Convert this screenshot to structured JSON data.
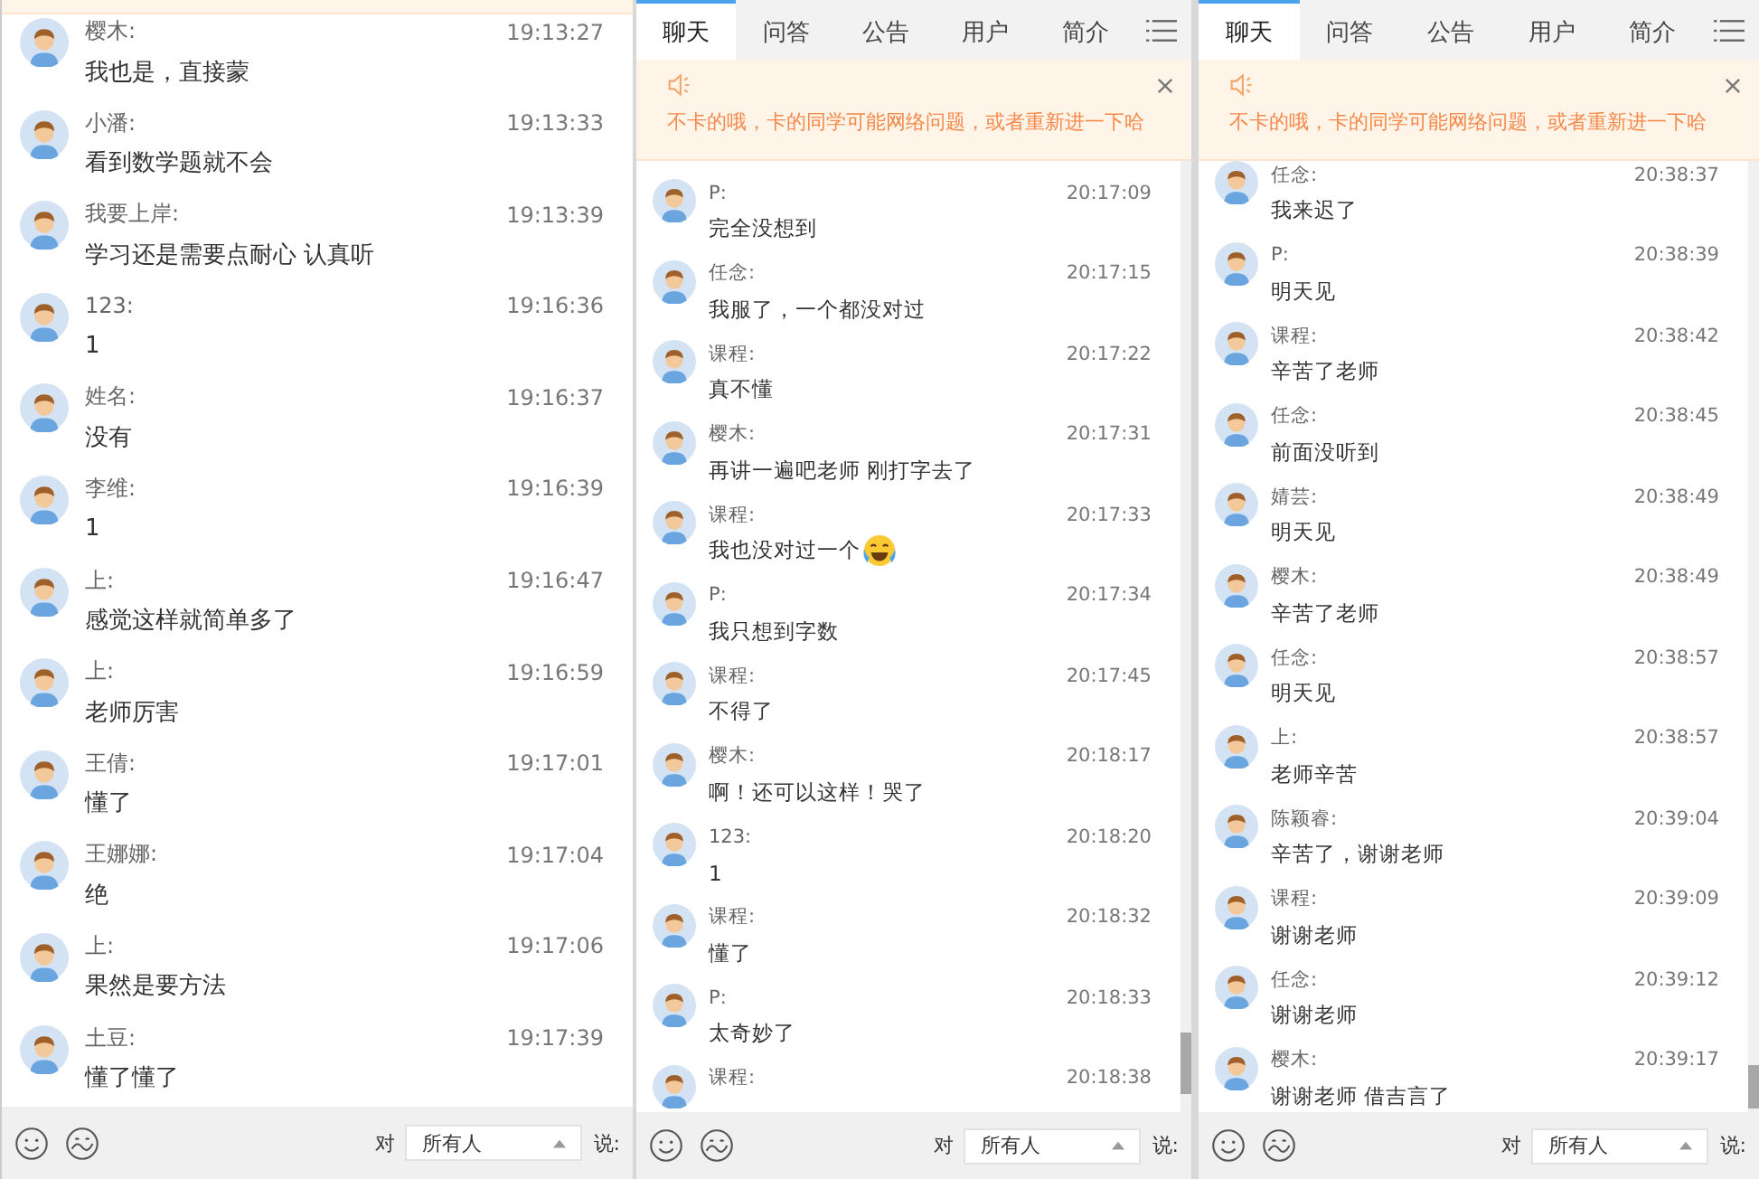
{
  "panels": [
    {
      "notice": {
        "collapsed": true
      },
      "messages": [
        {
          "name": "樱木:",
          "time": "19:13:27",
          "text": "我也是，直接蒙"
        },
        {
          "name": "小潘:",
          "time": "19:13:33",
          "text": "看到数学题就不会"
        },
        {
          "name": "我要上岸:",
          "time": "19:13:39",
          "text": "学习还是需要点耐心 认真听"
        },
        {
          "name": "123:",
          "time": "19:16:36",
          "text": "1"
        },
        {
          "name": "姓名:",
          "time": "19:16:37",
          "text": "没有"
        },
        {
          "name": "李维:",
          "time": "19:16:39",
          "text": "1"
        },
        {
          "name": "上:",
          "time": "19:16:47",
          "text": "感觉这样就简单多了"
        },
        {
          "name": "上:",
          "time": "19:16:59",
          "text": "老师厉害"
        },
        {
          "name": "王倩:",
          "time": "19:17:01",
          "text": "懂了"
        },
        {
          "name": "王娜娜:",
          "time": "19:17:04",
          "text": "绝"
        },
        {
          "name": "上:",
          "time": "19:17:06",
          "text": "果然是要方法"
        },
        {
          "name": "土豆:",
          "time": "19:17:39",
          "text": "懂了懂了"
        }
      ],
      "footer": {
        "to_label": "对",
        "recipient": "所有人",
        "say_label": "说:"
      }
    },
    {
      "tabs": [
        {
          "label": "聊天",
          "selected": true
        },
        {
          "label": "问答",
          "selected": false
        },
        {
          "label": "公告",
          "selected": false
        },
        {
          "label": "用户",
          "selected": false
        },
        {
          "label": "简介",
          "selected": false
        }
      ],
      "notice": {
        "collapsed": false,
        "text": "不卡的哦，卡的同学可能网络问题，或者重新进一下哈"
      },
      "scrollbar": true,
      "messages": [
        {
          "name": "P:",
          "time": "20:17:09",
          "text": "完全没想到"
        },
        {
          "name": "任念:",
          "time": "20:17:15",
          "text": "我服了，一个都没对过"
        },
        {
          "name": "课程:",
          "time": "20:17:22",
          "text": "真不懂"
        },
        {
          "name": "樱木:",
          "time": "20:17:31",
          "text": "再讲一遍吧老师 刚打字去了"
        },
        {
          "name": "课程:",
          "time": "20:17:33",
          "text": "我也没对过一个",
          "emoji": true
        },
        {
          "name": "P:",
          "time": "20:17:34",
          "text": "我只想到字数"
        },
        {
          "name": "课程:",
          "time": "20:17:45",
          "text": "不得了"
        },
        {
          "name": "樱木:",
          "time": "20:18:17",
          "text": "啊！还可以这样！哭了"
        },
        {
          "name": "123:",
          "time": "20:18:20",
          "text": "1"
        },
        {
          "name": "课程:",
          "time": "20:18:32",
          "text": "懂了"
        },
        {
          "name": "P:",
          "time": "20:18:33",
          "text": "太奇妙了"
        },
        {
          "name": "课程:",
          "time": "20:18:38"
        }
      ],
      "footer": {
        "to_label": "对",
        "recipient": "所有人",
        "say_label": "说:"
      }
    },
    {
      "tabs": [
        {
          "label": "聊天",
          "selected": true
        },
        {
          "label": "问答",
          "selected": false
        },
        {
          "label": "公告",
          "selected": false
        },
        {
          "label": "用户",
          "selected": false
        },
        {
          "label": "简介",
          "selected": false
        }
      ],
      "notice": {
        "collapsed": false,
        "text": "不卡的哦，卡的同学可能网络问题，或者重新进一下哈"
      },
      "scrollbar": true,
      "messages": [
        {
          "name": "任念:",
          "time": "20:38:37",
          "text": "我来迟了"
        },
        {
          "name": "P:",
          "time": "20:38:39",
          "text": "明天见"
        },
        {
          "name": "课程:",
          "time": "20:38:42",
          "text": "辛苦了老师"
        },
        {
          "name": "任念:",
          "time": "20:38:45",
          "text": "前面没听到"
        },
        {
          "name": "婧芸:",
          "time": "20:38:49",
          "text": "明天见"
        },
        {
          "name": "樱木:",
          "time": "20:38:49",
          "text": "辛苦了老师"
        },
        {
          "name": "任念:",
          "time": "20:38:57",
          "text": "明天见"
        },
        {
          "name": "上:",
          "time": "20:38:57",
          "text": "老师辛苦"
        },
        {
          "name": "陈颖睿:",
          "time": "20:39:04",
          "text": "辛苦了，谢谢老师"
        },
        {
          "name": "课程:",
          "time": "20:39:09",
          "text": "谢谢老师"
        },
        {
          "name": "任念:",
          "time": "20:39:12",
          "text": "谢谢老师"
        },
        {
          "name": "樱木:",
          "time": "20:39:17",
          "text": "谢谢老师 借吉言了"
        }
      ],
      "footer": {
        "to_label": "对",
        "recipient": "所有人",
        "say_label": "说:"
      }
    }
  ]
}
